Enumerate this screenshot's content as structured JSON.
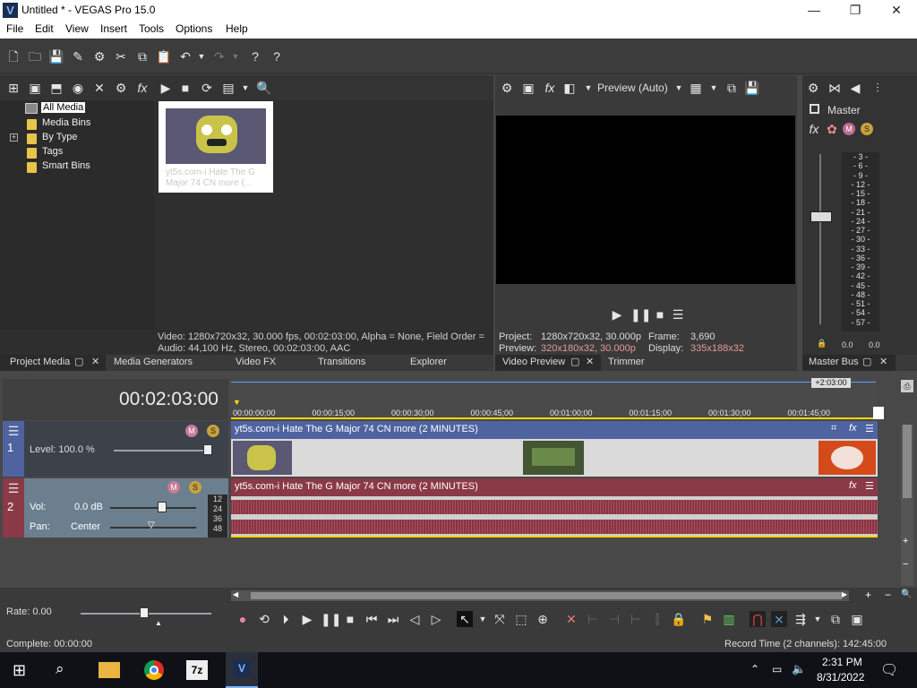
{
  "window": {
    "title": "Untitled * - VEGAS Pro 15.0",
    "app_icon_letter": "V",
    "minimize": "—",
    "maximize": "❐",
    "close": "✕"
  },
  "menu": [
    "File",
    "Edit",
    "View",
    "Insert",
    "Tools",
    "Options",
    "Help"
  ],
  "media_tree": {
    "items": [
      "All Media",
      "Media Bins",
      "By Type",
      "Tags",
      "Smart Bins"
    ],
    "expander": "+"
  },
  "media_thumb": {
    "caption": "yt5s.com-i Hate The G Major 74 CN more (..."
  },
  "media_info": {
    "video": "Video: 1280x720x32, 30.000 fps, 00:02:03:00, Alpha = None, Field Order =",
    "audio": "Audio: 44,100 Hz, Stereo, 00:02:03:00, AAC"
  },
  "left_tabs": [
    "Project Media",
    "Media Generators",
    "Video FX",
    "Transitions",
    "Explorer"
  ],
  "preview": {
    "mode_label": "Preview (Auto)",
    "project_label": "Project:",
    "project_value": "1280x720x32, 30.000p",
    "frame_label": "Frame:",
    "frame_value": "3,690",
    "preview_label": "Preview:",
    "preview_value": "320x180x32, 30.000p",
    "display_label": "Display:",
    "display_value": "335x188x32",
    "tabs": [
      "Video Preview",
      "Trimmer"
    ]
  },
  "master": {
    "title": "Master",
    "scale": [
      "3",
      "6",
      "9",
      "12",
      "15",
      "18",
      "21",
      "24",
      "27",
      "30",
      "33",
      "36",
      "39",
      "42",
      "45",
      "48",
      "51",
      "54",
      "57"
    ],
    "left_value": "0.0",
    "right_value": "0.0",
    "tab": "Master Bus"
  },
  "timeline": {
    "timecode": "00:02:03:00",
    "end_marker": "+2:03:00",
    "ruler": [
      "00:00:00;00",
      "00:00:15;00",
      "00:00:30;00",
      "00:00:45;00",
      "00:01:00;00",
      "00:01:15;00",
      "00:01:30;00",
      "00:01:45;00"
    ],
    "audio_db_marks": [
      "12",
      "24",
      "36",
      "48"
    ]
  },
  "tracks": {
    "video": {
      "number": "1",
      "level_label": "Level: 100.0 %",
      "clip_title": "yt5s.com-i Hate The G Major 74 CN more (2 MINUTES)"
    },
    "audio": {
      "number": "2",
      "vol_label": "Vol:",
      "vol_value": "0.0 dB",
      "pan_label": "Pan:",
      "pan_value": "Center",
      "clip_title": "yt5s.com-i Hate The G Major 74 CN more (2 MINUTES)"
    }
  },
  "rate": "Rate: 0.00",
  "status": {
    "complete": "Complete: 00:00:00",
    "record_time": "Record Time (2 channels): 142:45:00"
  },
  "taskbar": {
    "time": "2:31 PM",
    "date": "8/31/2022",
    "sevenzip": "7z"
  },
  "colors": {
    "video_track": "#4f63a0",
    "audio_track": "#8a3947",
    "waveform": "#7a1a2a"
  }
}
